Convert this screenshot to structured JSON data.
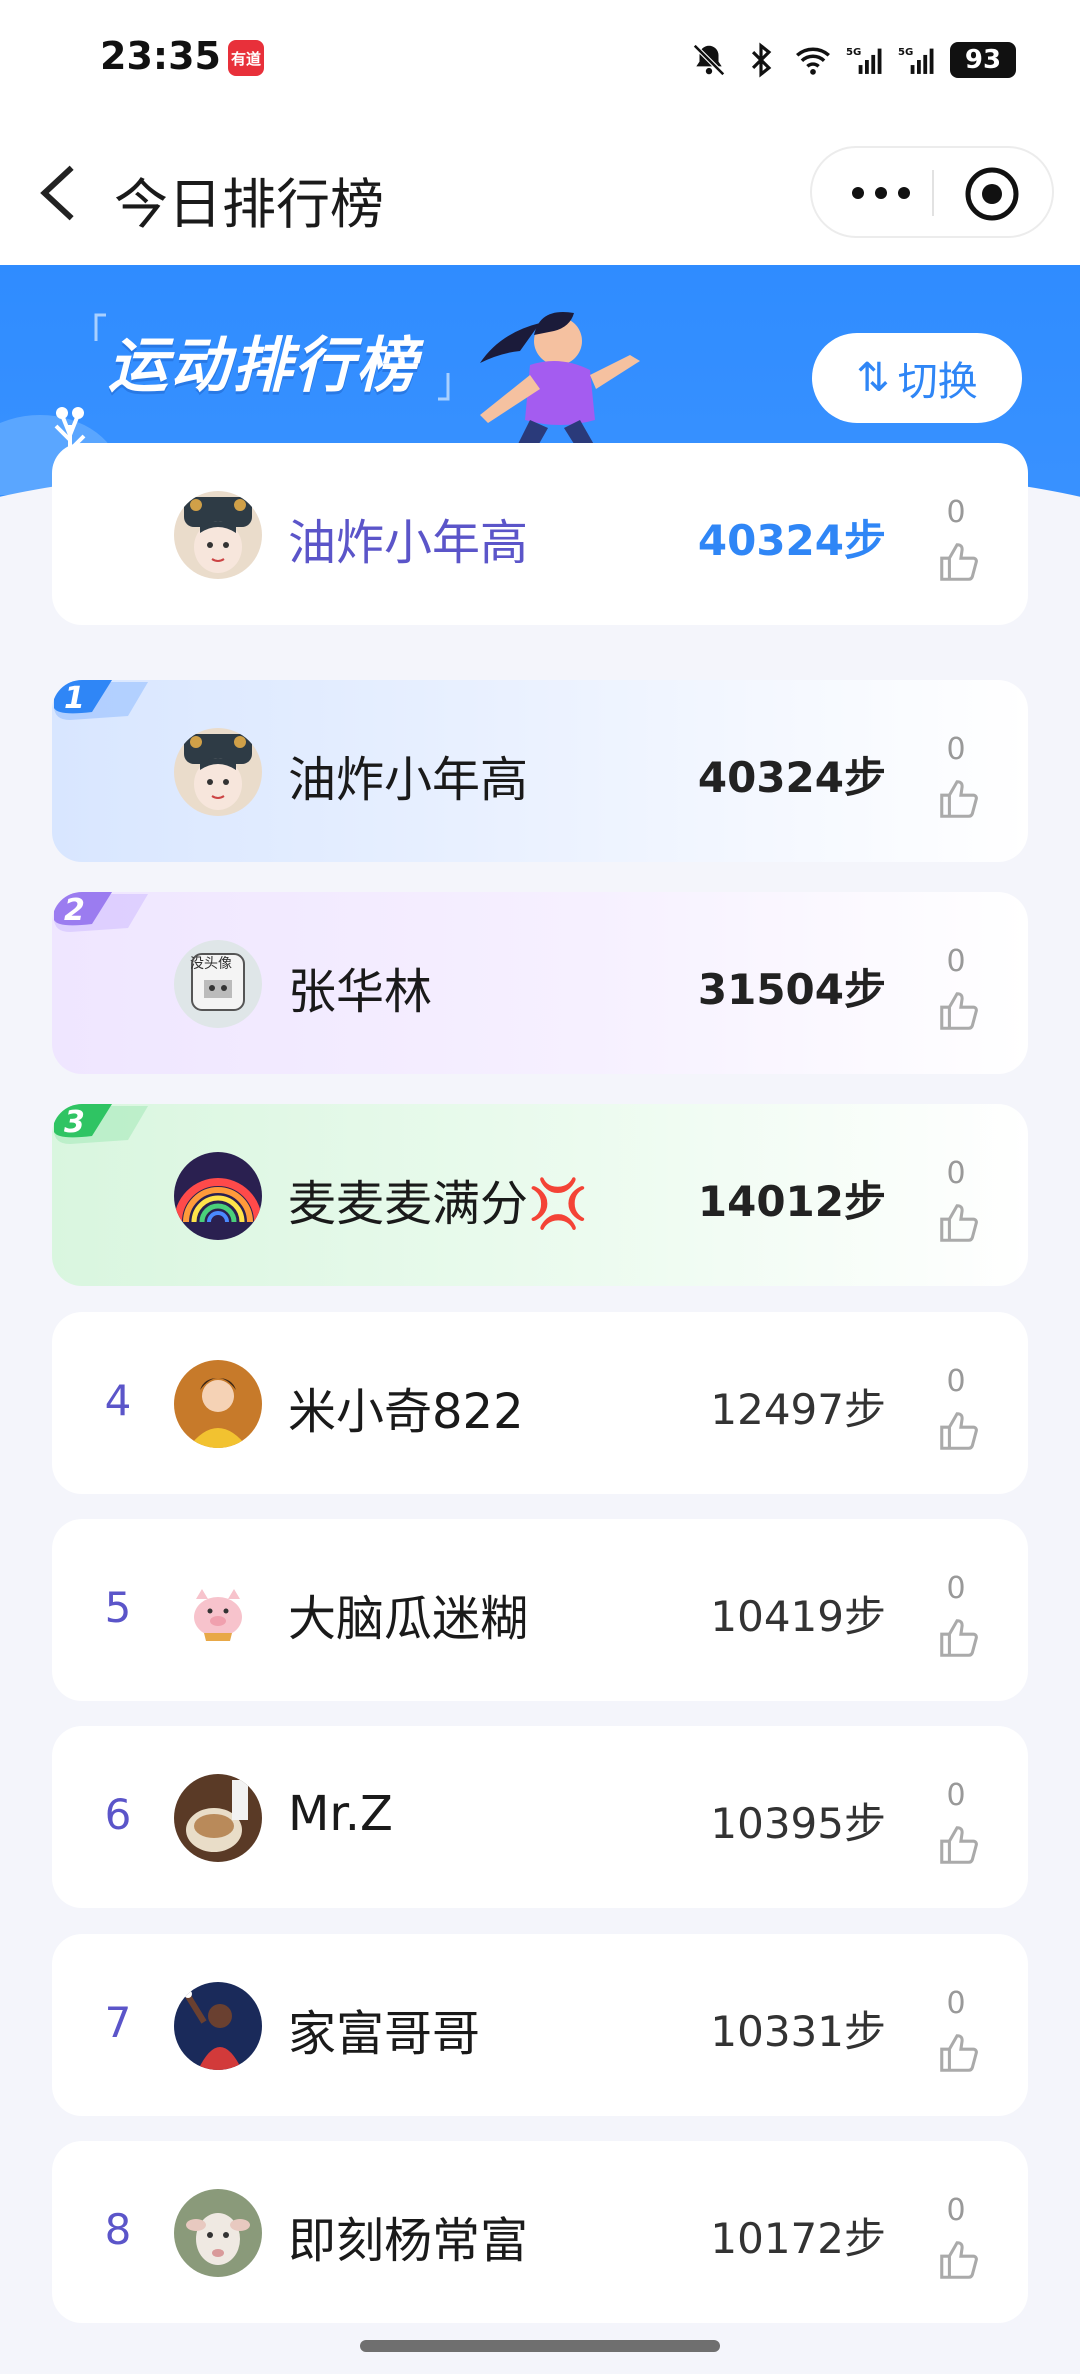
{
  "status_bar": {
    "time": "23:35",
    "app_icon_text": "有道",
    "battery": "93",
    "icons": [
      "mute-bell-icon",
      "bluetooth-icon",
      "wifi-icon",
      "5g-signal-icon",
      "5g-signal-icon"
    ]
  },
  "nav": {
    "title": "今日排行榜"
  },
  "banner": {
    "title": "运动排行榜",
    "switch_label": "切换",
    "switch_icon": "⇅",
    "bg_color": "#2f8cff"
  },
  "my_entry": {
    "name": "油炸小年高",
    "steps": "40324步",
    "likes": "0"
  },
  "rankings": [
    {
      "rank": "1",
      "name": "油炸小年高",
      "steps": "40324步",
      "likes": "0"
    },
    {
      "rank": "2",
      "name": "张华林",
      "steps": "31504步",
      "likes": "0"
    },
    {
      "rank": "3",
      "name": "麦麦麦满分💢",
      "steps": "14012步",
      "likes": "0"
    },
    {
      "rank": "4",
      "name": "米小奇822",
      "steps": "12497步",
      "likes": "0"
    },
    {
      "rank": "5",
      "name": "大脑瓜迷糊",
      "steps": "10419步",
      "likes": "0"
    },
    {
      "rank": "6",
      "name": "Mr.Z",
      "steps": "10395步",
      "likes": "0"
    },
    {
      "rank": "7",
      "name": "家富哥哥",
      "steps": "10331步",
      "likes": "0"
    },
    {
      "rank": "8",
      "name": "即刻杨常富",
      "steps": "10172步",
      "likes": "0"
    }
  ],
  "colors": {
    "accent": "#2f86f6",
    "rank_number": "#5b55c9",
    "rank1_badge": "#2f86f6",
    "rank2_badge": "#9b7cf0",
    "rank3_badge": "#2fc463"
  }
}
